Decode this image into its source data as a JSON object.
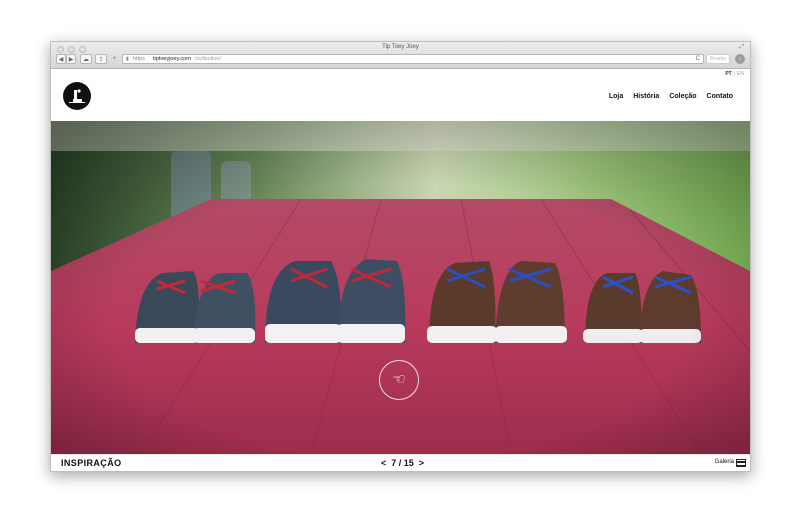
{
  "window": {
    "title": "Tip Toey Joey"
  },
  "toolbar": {
    "back_glyph": "◀",
    "forward_glyph": "▶",
    "icloud_glyph": "☁",
    "share_glyph": "⇪",
    "add_glyph": "+",
    "reload_glyph": "C",
    "reader_label": "Reader",
    "download_glyph": "↓"
  },
  "url": {
    "scheme": "https",
    "domain": "tiptoeyjoey.com",
    "path": "/collection/"
  },
  "site": {
    "lang_active": "PT",
    "lang_other": "EN",
    "nav": [
      "Loja",
      "História",
      "Coleção",
      "Contato"
    ]
  },
  "footer": {
    "section": "INSPIRAÇÃO",
    "prev": "<",
    "counter": "7 / 15",
    "next": ">",
    "gallery": "Galeria"
  },
  "hero": {
    "gesture_icon": "swipe-hand-icon",
    "gesture_glyph": "☜"
  },
  "colors": {
    "table": "#b23c5c",
    "grass": "#8fc26a",
    "text": "#111111"
  }
}
